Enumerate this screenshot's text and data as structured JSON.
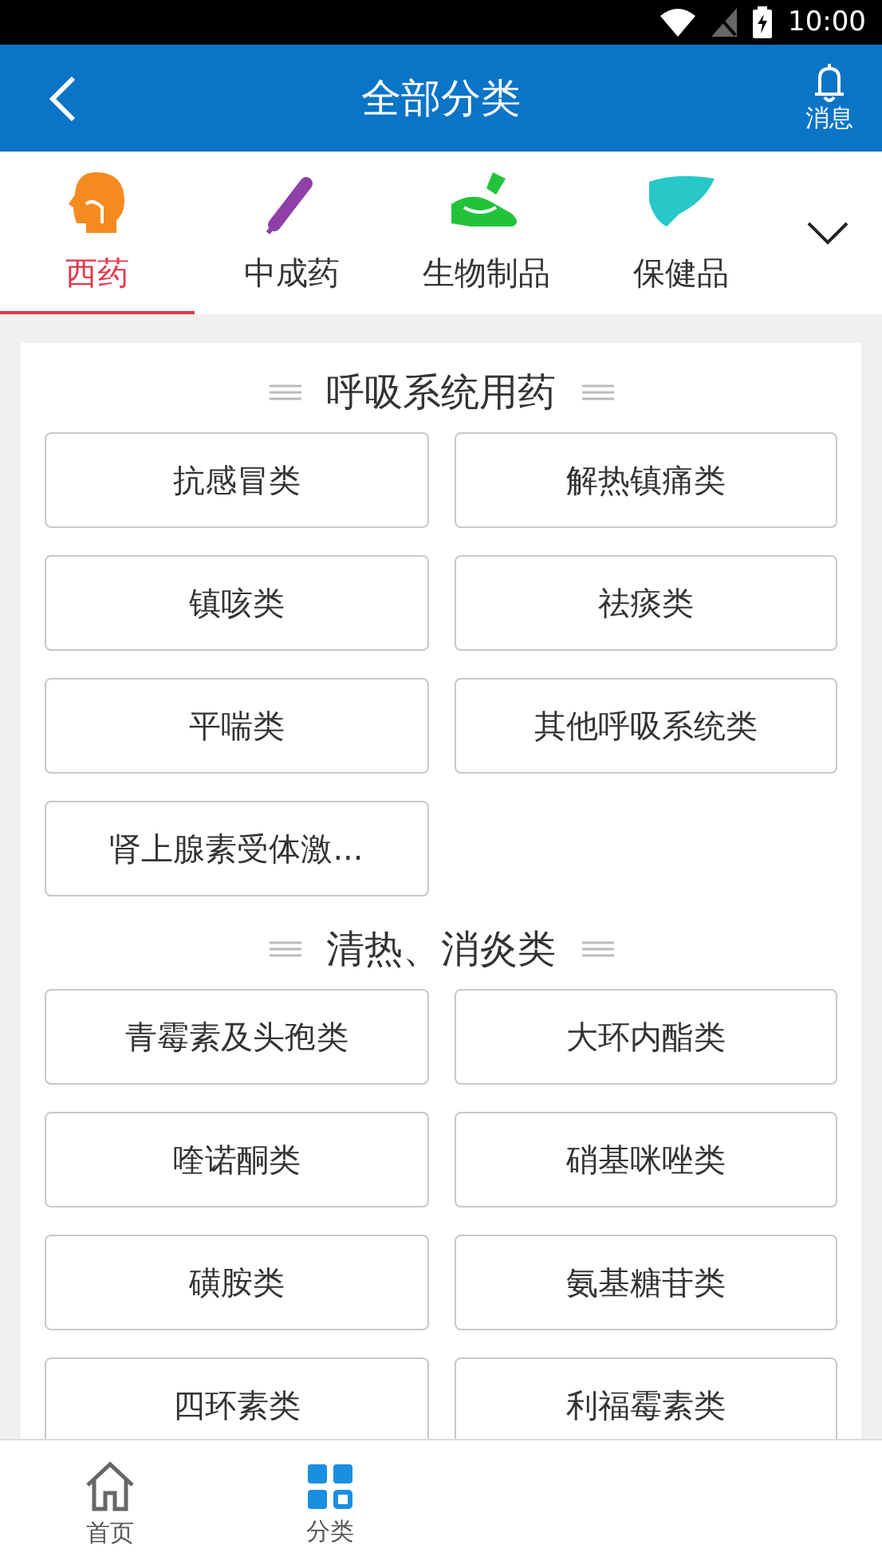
{
  "status_bar": {
    "time": "10:00"
  },
  "header": {
    "title": "全部分类",
    "message_label": "消息"
  },
  "tabs": [
    {
      "label": "西药",
      "kind": "head",
      "selected": true
    },
    {
      "label": "中成药",
      "kind": "capsule",
      "selected": false
    },
    {
      "label": "生物制品",
      "kind": "hand",
      "selected": false
    },
    {
      "label": "保健品",
      "kind": "liver",
      "selected": false
    }
  ],
  "sections": [
    {
      "title": "呼吸系统用药",
      "items": [
        "抗感冒类",
        "解热镇痛类",
        "镇咳类",
        "祛痰类",
        "平喘类",
        "其他呼吸系统类",
        "肾上腺素受体激..."
      ]
    },
    {
      "title": "清热、消炎类",
      "items": [
        "青霉素及头孢类",
        "大环内酯类",
        "喹诺酮类",
        "硝基咪唑类",
        "磺胺类",
        "氨基糖苷类",
        "四环素类",
        "利福霉素类"
      ]
    }
  ],
  "bottom_nav": [
    {
      "label": "首页",
      "kind": "home",
      "selected": false
    },
    {
      "label": "分类",
      "kind": "grid",
      "selected": true
    }
  ]
}
